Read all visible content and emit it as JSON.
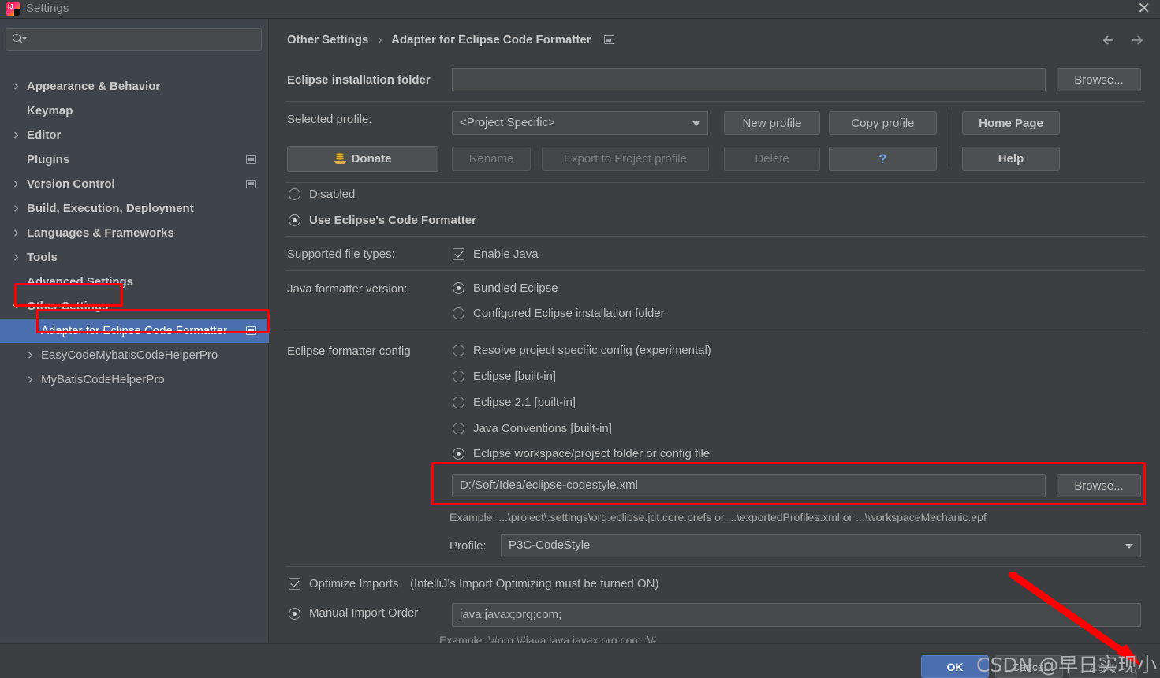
{
  "window": {
    "title": "Settings",
    "logo_icon": "intellij-idea-logo",
    "close_icon": "close-icon"
  },
  "sidebar": {
    "search": {
      "placeholder": "",
      "value": "",
      "icon": "search-icon"
    },
    "items": [
      {
        "label": "Appearance & Behavior",
        "chevron": true,
        "bold": true,
        "indent": false,
        "badge": false,
        "selected": false
      },
      {
        "label": "Keymap",
        "chevron": false,
        "bold": true,
        "indent": false,
        "badge": false,
        "selected": false
      },
      {
        "label": "Editor",
        "chevron": true,
        "bold": true,
        "indent": false,
        "badge": false,
        "selected": false
      },
      {
        "label": "Plugins",
        "chevron": false,
        "bold": true,
        "indent": false,
        "badge": true,
        "selected": false
      },
      {
        "label": "Version Control",
        "chevron": true,
        "bold": true,
        "indent": false,
        "badge": true,
        "selected": false
      },
      {
        "label": "Build, Execution, Deployment",
        "chevron": true,
        "bold": true,
        "indent": false,
        "badge": false,
        "selected": false
      },
      {
        "label": "Languages & Frameworks",
        "chevron": true,
        "bold": true,
        "indent": false,
        "badge": false,
        "selected": false
      },
      {
        "label": "Tools",
        "chevron": true,
        "bold": true,
        "indent": false,
        "badge": false,
        "selected": false
      },
      {
        "label": "Advanced Settings",
        "chevron": false,
        "bold": true,
        "indent": false,
        "badge": false,
        "selected": false
      },
      {
        "label": "Other Settings",
        "chevron": true,
        "expanded": true,
        "bold": true,
        "indent": false,
        "badge": false,
        "selected": false
      },
      {
        "label": "Adapter for Eclipse Code Formatter",
        "chevron": false,
        "bold": false,
        "indent": true,
        "badge": true,
        "selected": true
      },
      {
        "label": "EasyCodeMybatisCodeHelperPro",
        "chevron": true,
        "bold": false,
        "indent": true,
        "badge": false,
        "selected": false
      },
      {
        "label": "MyBatisCodeHelperPro",
        "chevron": true,
        "bold": false,
        "indent": true,
        "badge": false,
        "selected": false
      }
    ],
    "help_icon": "question-mark-icon"
  },
  "header": {
    "breadcrumb_parent": "Other Settings",
    "breadcrumb_separator": "›",
    "breadcrumb_current": "Adapter for Eclipse Code Formatter",
    "badge_icon": "project-scope-icon",
    "back_icon": "arrow-left-icon",
    "forward_icon": "arrow-right-icon"
  },
  "main": {
    "eclipse_install": {
      "label": "Eclipse installation folder",
      "value": "",
      "placeholder": "",
      "browse_label": "Browse..."
    },
    "profile_row": {
      "label": "Selected profile:",
      "selected": "<Project Specific>",
      "new_profile": "New profile",
      "copy_profile": "Copy profile",
      "home_page": "Home Page"
    },
    "actions_row": {
      "donate": "Donate",
      "donate_icon": "donate-coins-icon",
      "rename": "Rename",
      "export": "Export to Project profile",
      "delete": "Delete",
      "question": "?",
      "help": "Help"
    },
    "mode_options": [
      {
        "label": "Disabled",
        "checked": false,
        "bold": false
      },
      {
        "label": "Use Eclipse's Code Formatter",
        "checked": true,
        "bold": true
      }
    ],
    "supported_file_types": {
      "label": "Supported file types:",
      "enable_java": "Enable Java",
      "enable_java_checked": true
    },
    "java_formatter_version": {
      "label": "Java formatter version:",
      "options": [
        {
          "label": "Bundled Eclipse",
          "checked": true
        },
        {
          "label": "Configured Eclipse installation folder",
          "checked": false
        }
      ]
    },
    "formatter_config": {
      "label": "Eclipse formatter config",
      "options": [
        {
          "label": "Resolve project specific config (experimental)",
          "checked": false
        },
        {
          "label": "Eclipse [built-in]",
          "checked": false
        },
        {
          "label": "Eclipse 2.1 [built-in]",
          "checked": false
        },
        {
          "label": "Java Conventions [built-in]",
          "checked": false
        },
        {
          "label": "Eclipse workspace/project folder or config file",
          "checked": true
        }
      ],
      "path_value": "D:/Soft/Idea/eclipse-codestyle.xml",
      "browse_label": "Browse...",
      "example": "Example: ...\\project\\.settings\\org.eclipse.jdt.core.prefs or ...\\exportedProfiles.xml or ...\\workspaceMechanic.epf",
      "profile_label": "Profile:",
      "profile_value": "P3C-CodeStyle"
    },
    "optimize_imports": {
      "checked": true,
      "label": "Optimize Imports",
      "note": "(IntelliJ's Import Optimizing must be turned ON)"
    },
    "manual_import_order": {
      "checked": true,
      "label": "Manual Import Order",
      "value": "java;javax;org;com;",
      "example": "Example: \\#org;\\#java;java;javax;org;com;;\\#"
    }
  },
  "footer": {
    "ok": "OK",
    "cancel": "Cancel",
    "apply": "Apply"
  },
  "annotations": {
    "watermark": "CSDN @早日实现小目标",
    "accent_red": "#ff0000",
    "selection_blue": "#4b6eaf"
  }
}
